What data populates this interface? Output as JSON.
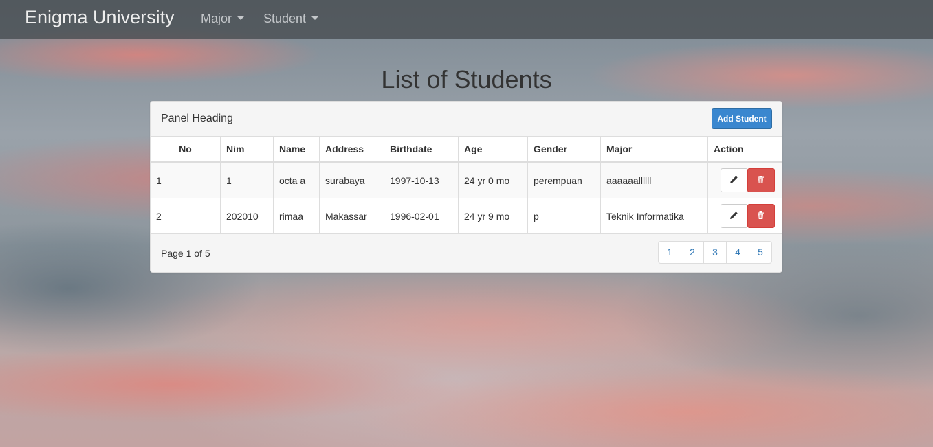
{
  "navbar": {
    "brand": "Enigma University",
    "menus": [
      {
        "label": "Major"
      },
      {
        "label": "Student"
      }
    ]
  },
  "page_title": "List of Students",
  "panel": {
    "heading": "Panel Heading",
    "add_button": "Add Student"
  },
  "table": {
    "columns": [
      "No",
      "Nim",
      "Name",
      "Address",
      "Birthdate",
      "Age",
      "Gender",
      "Major",
      "Action"
    ],
    "rows": [
      {
        "no": "1",
        "nim": "1",
        "name": "octa a",
        "address": "surabaya",
        "birthdate": "1997-10-13",
        "age": "24 yr 0 mo",
        "gender": "perempuan",
        "major": "aaaaaallllll"
      },
      {
        "no": "2",
        "nim": "202010",
        "name": "rimaa",
        "address": "Makassar",
        "birthdate": "1996-02-01",
        "age": "24 yr 9 mo",
        "gender": "p",
        "major": "Teknik Informatika"
      }
    ]
  },
  "pagination": {
    "info": "Page 1 of 5",
    "pages": [
      "1",
      "2",
      "3",
      "4",
      "5"
    ],
    "link_color": "#337ab7"
  },
  "colors": {
    "primary": "#3a87cf",
    "danger": "#d9534f"
  }
}
